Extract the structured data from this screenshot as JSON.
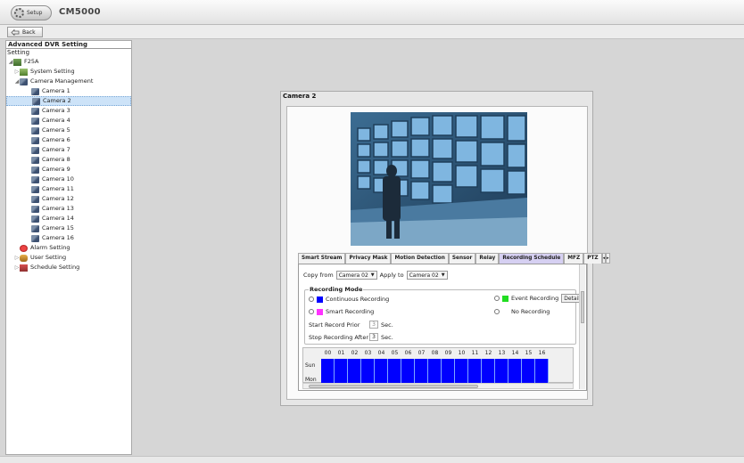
{
  "app": {
    "title": "CM5000",
    "setup_label": "Setup",
    "back_label": "Back"
  },
  "left_panel": {
    "header": "Advanced DVR Setting",
    "subheader": "Setting",
    "root": "F25A",
    "system_setting": "System Setting",
    "camera_management": "Camera Management",
    "cameras": [
      "Camera 1",
      "Camera 2",
      "Camera 3",
      "Camera 4",
      "Camera 5",
      "Camera 6",
      "Camera 7",
      "Camera 8",
      "Camera 9",
      "Camera 10",
      "Camera 11",
      "Camera 12",
      "Camera 13",
      "Camera 14",
      "Camera 15",
      "Camera 16"
    ],
    "selected_camera": "Camera 2",
    "alarm_setting": "Alarm Setting",
    "user_setting": "User Setting",
    "schedule_setting": "Schedule Setting"
  },
  "main": {
    "title": "Camera 2",
    "tabs": [
      "Smart Stream",
      "Privacy Mask",
      "Motion Detection",
      "Sensor",
      "Relay",
      "Recording Schedule",
      "MFZ",
      "PTZ"
    ],
    "active_tab": "Recording Schedule",
    "copy_from_label": "Copy from",
    "copy_from_value": "Camera 02",
    "apply_to_label": "Apply to",
    "apply_to_value": "Camera 02",
    "recording_mode_title": "Recording Mode",
    "modes": {
      "continuous": "Continuous Recording",
      "smart": "Smart Recording",
      "event": "Event Recording",
      "none": "No Recording"
    },
    "detail_label": "Detail",
    "start_prior_label": "Start Record Prior",
    "start_prior_value": "3",
    "stop_after_label": "Stop Recording After",
    "stop_after_value": "3",
    "sec_label": "Sec.",
    "hours": [
      "00",
      "01",
      "02",
      "03",
      "04",
      "05",
      "06",
      "07",
      "08",
      "09",
      "10",
      "11",
      "12",
      "13",
      "14",
      "15",
      "16"
    ],
    "days": [
      "Sun",
      "Mon"
    ],
    "colors": {
      "continuous": "#0000ff",
      "smart": "#ff33ff",
      "event": "#22dd22",
      "none": "#ffffff"
    }
  }
}
